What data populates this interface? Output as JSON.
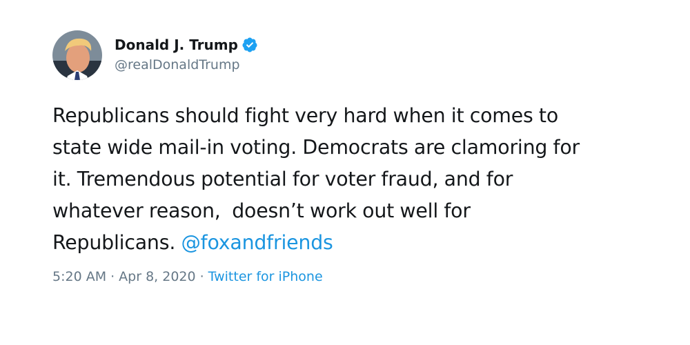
{
  "author": {
    "display_name": "Donald J. Trump",
    "handle": "@realDonaldTrump",
    "verified_icon": "verified-badge-icon",
    "avatar": "profile-photo"
  },
  "tweet": {
    "lines": [
      "Republicans should fight very hard when it comes to",
      "state wide mail-in voting. Democrats are clamoring for",
      "it. Tremendous potential for voter fraud, and for",
      "whatever reason,  doesn’t work out well for",
      "Republicans. "
    ],
    "mention": "@foxandfriends"
  },
  "meta": {
    "time": "5:20 AM",
    "separator": "·",
    "date": "Apr 8, 2020",
    "source": "Twitter for iPhone"
  },
  "colors": {
    "text": "#14171a",
    "secondary": "#657786",
    "link": "#1b95e0",
    "verified": "#1da1f2"
  }
}
